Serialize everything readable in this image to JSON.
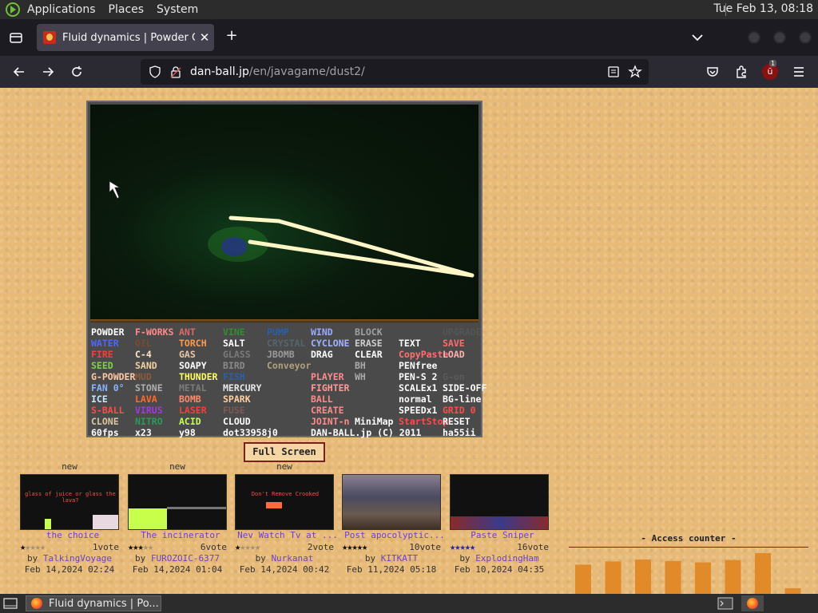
{
  "top_panel": {
    "menus": [
      "Applications",
      "Places",
      "System"
    ],
    "clock": "Tue Feb 13, 08:18"
  },
  "browser": {
    "tab_title": "Fluid dynamics | Powder Game",
    "url_host": "dan-ball.jp",
    "url_path": "/en/javagame/dust2/",
    "extension_badge": "1"
  },
  "game": {
    "rows": [
      [
        [
          "POWDER",
          "#ffffff"
        ],
        [
          "F-WORKS",
          "#ff8a8a"
        ],
        [
          "ANT",
          "#d86a6a"
        ],
        [
          "VINE",
          "#2f8f2f"
        ],
        [
          "PUMP",
          "#2a5fae"
        ],
        [
          "WIND",
          "#9aa8ff"
        ],
        [
          "BLOCK",
          "#a0a0a0"
        ],
        [
          "",
          "#888"
        ],
        [
          "UPGRADE",
          "#555555"
        ]
      ],
      [
        [
          "WATER",
          "#4a68ff"
        ],
        [
          "OIL",
          "#7a4a2a"
        ],
        [
          "TORCH",
          "#ff9a4a"
        ],
        [
          "SALT",
          "#ffffff"
        ],
        [
          "CRYSTAL",
          "#55666e"
        ],
        [
          "CYCLONE",
          "#a0b4ff"
        ],
        [
          "ERASE",
          "#cfcfcf"
        ],
        [
          "TEXT",
          "#ffffff"
        ],
        [
          "SAVE",
          "#ff6a6a"
        ]
      ],
      [
        [
          "FIRE",
          "#ff3a3a"
        ],
        [
          "C-4",
          "#ffe4c4"
        ],
        [
          "GAS",
          "#e8c8a8"
        ],
        [
          "GLASS",
          "#7a7a7a"
        ],
        [
          "JBOMB",
          "#9a9a9a"
        ],
        [
          "DRAG",
          "#ffffff"
        ],
        [
          "CLEAR",
          "#ffffff"
        ],
        [
          "CopyPaste",
          "#ff7070"
        ],
        [
          "LOAD",
          "#ffb0b0"
        ]
      ],
      [
        [
          "SEED",
          "#7fd14a"
        ],
        [
          "SAND",
          "#f0d0a0"
        ],
        [
          "SOAPY",
          "#ffffff"
        ],
        [
          "BIRD",
          "#8a8a8a"
        ],
        [
          "Conveyor",
          "#b0a080"
        ],
        [
          "",
          "#888"
        ],
        [
          "BH",
          "#aaaaaa"
        ],
        [
          "PENfree",
          "#ffffff"
        ],
        [
          "",
          "#888"
        ]
      ],
      [
        [
          "G-POWDER",
          "#ffc8a8"
        ],
        [
          "MUD",
          "#8a5a3a"
        ],
        [
          "THUNDER",
          "#ffff60"
        ],
        [
          "FISH",
          "#2a5fae"
        ],
        [
          "",
          "#888"
        ],
        [
          "PLAYER",
          "#ff8a8a"
        ],
        [
          "WH",
          "#aaaaaa"
        ],
        [
          "PEN-S 2",
          "#ffffff"
        ],
        [
          "G-on",
          "#5a5a5a"
        ]
      ],
      [
        [
          "FAN 0°",
          "#8ab4ff"
        ],
        [
          "STONE",
          "#b0b0b0"
        ],
        [
          "METAL",
          "#7a7a7a"
        ],
        [
          "MERCURY",
          "#e8e8e8"
        ],
        [
          "",
          "#888"
        ],
        [
          "FIGHTER",
          "#ff9a9a"
        ],
        [
          "",
          "#888"
        ],
        [
          "SCALEx1",
          "#ffffff"
        ],
        [
          "SIDE-OFF",
          "#ffffff"
        ]
      ],
      [
        [
          "ICE",
          "#c8e8ff"
        ],
        [
          "LAVA",
          "#ff6a2a"
        ],
        [
          "BOMB",
          "#ff8a6a"
        ],
        [
          "SPARK",
          "#ffd0a0"
        ],
        [
          "",
          "#888"
        ],
        [
          "BALL",
          "#ff8a8a"
        ],
        [
          "",
          "#888"
        ],
        [
          "normal",
          "#ffffff"
        ],
        [
          "BG-line",
          "#ffffff"
        ]
      ],
      [
        [
          "S-BALL",
          "#ff4a4a"
        ],
        [
          "VIRUS",
          "#a03ad8"
        ],
        [
          "LASER",
          "#ff3a3a"
        ],
        [
          "FUSE",
          "#7a5a5a"
        ],
        [
          "",
          "#888"
        ],
        [
          "CREATE",
          "#ff8a8a"
        ],
        [
          "",
          "#888"
        ],
        [
          "SPEEDx1",
          "#ffffff"
        ],
        [
          "GRID 0",
          "#ff4a4a"
        ]
      ],
      [
        [
          "CLONE",
          "#d8c8a0"
        ],
        [
          "NITRO",
          "#2a9a5a"
        ],
        [
          "ACID",
          "#c8ff4a"
        ],
        [
          "CLOUD",
          "#ffffff"
        ],
        [
          "",
          "#888"
        ],
        [
          "JOINT-n",
          "#ff8a8a"
        ],
        [
          "MiniMap",
          "#ffffff"
        ],
        [
          "StartStop",
          "#ff4a4a"
        ],
        [
          "RESET",
          "#ffffff"
        ]
      ],
      [
        [
          "60fps",
          "#ffffff"
        ],
        [
          "x23",
          "#ffffff"
        ],
        [
          "y98",
          "#ffffff"
        ],
        [
          "dot33958",
          "#ffffff"
        ],
        [
          "j0",
          "#ffffff"
        ],
        [
          "DAN-BALL.jp (C) 2011",
          "#ffffff"
        ],
        [
          "",
          "#888"
        ],
        [
          "",
          "#888"
        ],
        [
          "ha55ii",
          "#ffffff"
        ]
      ]
    ],
    "fullscreen_label": "Full Screen"
  },
  "thumbnails": [
    {
      "new": "new",
      "title": "the choice",
      "stars": 1,
      "votes": "1vote",
      "by": "by",
      "author": "TalkingVoyage",
      "date": "Feb 14,2024 02:24",
      "star_color": "#111111",
      "img_text": "glass of juice or glass the lava?"
    },
    {
      "new": "new",
      "title": "The incinerator",
      "stars": 3,
      "votes": "6vote",
      "by": "by",
      "author": "FUROZOIC-6377",
      "date": "Feb 14,2024 01:04",
      "star_color": "#111111",
      "img_text": ""
    },
    {
      "new": "new",
      "title": "Nev Watch Tv at ...",
      "stars": 1,
      "votes": "2vote",
      "by": "by",
      "author": "Nurkanat",
      "date": "Feb 14,2024 00:42",
      "star_color": "#111111",
      "img_text": "Don't Remove Crooked"
    },
    {
      "new": "",
      "title": "Post apocolyptic...",
      "stars": 5,
      "votes": "10vote",
      "by": "by",
      "author": "KITKATT",
      "date": "Feb 11,2024 05:18",
      "star_color": "#111111",
      "img_text": ""
    },
    {
      "new": "",
      "title": "Paste Sniper",
      "stars": 5,
      "votes": "16vote",
      "by": "by",
      "author": "ExplodingHam",
      "date": "Feb 10,2024 04:35",
      "star_color": "#2222cc",
      "img_text": ""
    }
  ],
  "counter": {
    "title": "- Access counter -",
    "values": [
      0.63,
      0.7,
      0.74,
      0.71,
      0.68,
      0.73,
      0.88,
      0.12
    ]
  },
  "taskbar": {
    "window_title": "Fluid dynamics | Po..."
  }
}
